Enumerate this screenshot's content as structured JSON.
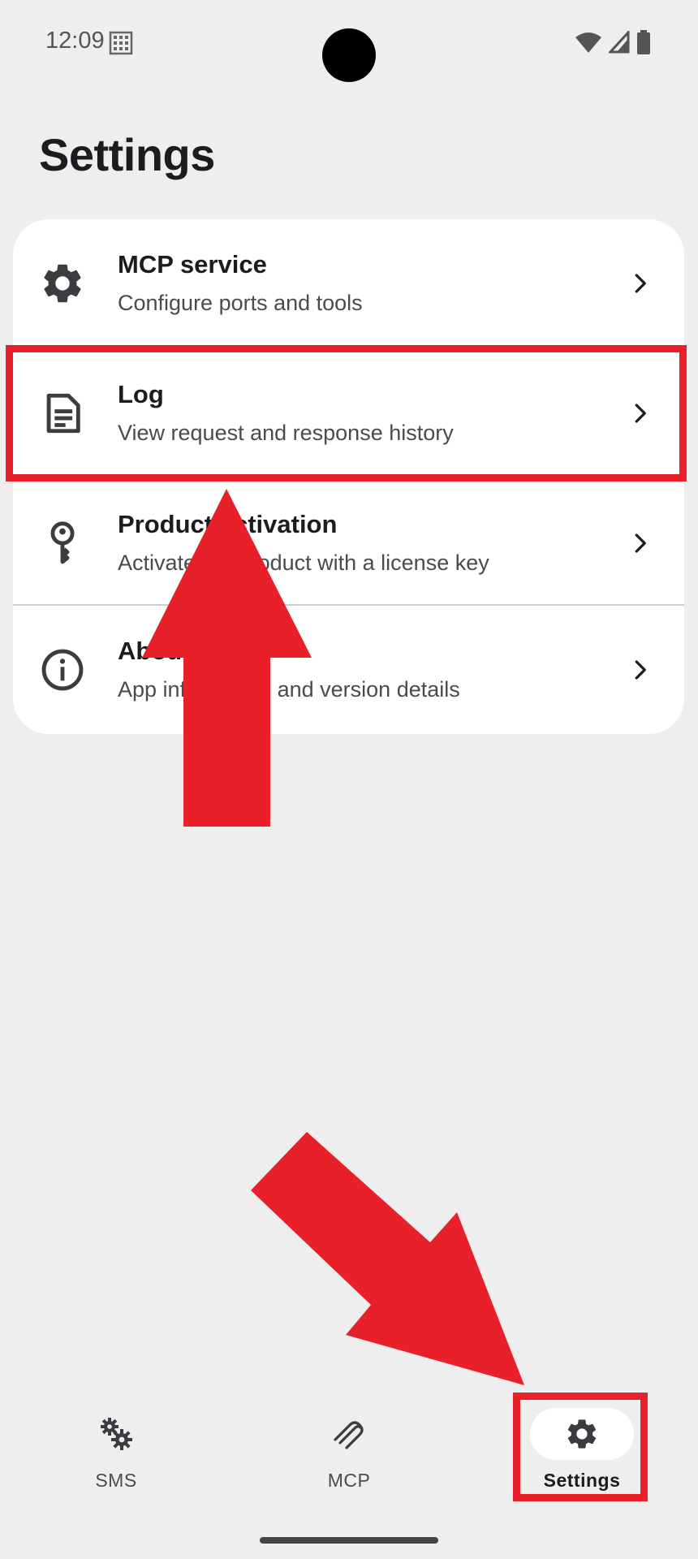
{
  "status_bar": {
    "time": "12:09",
    "icons": [
      "sim-card-icon",
      "wifi-icon",
      "cell-signal-icon",
      "battery-icon"
    ]
  },
  "page": {
    "title": "Settings"
  },
  "settings_items": [
    {
      "icon": "gear-icon",
      "title": "MCP service",
      "subtitle": "Configure ports and tools"
    },
    {
      "icon": "document-icon",
      "title": "Log",
      "subtitle": "View request and response history"
    },
    {
      "icon": "key-icon",
      "title": "Product activation",
      "subtitle": "Activate the product with a license key"
    },
    {
      "icon": "info-icon",
      "title": "About",
      "subtitle": "App information and version details"
    }
  ],
  "bottom_nav": [
    {
      "icon": "gears-icon",
      "label": "SMS",
      "active": false
    },
    {
      "icon": "paperclip-icon",
      "label": "MCP",
      "active": false
    },
    {
      "icon": "gear-icon",
      "label": "Settings",
      "active": true
    }
  ],
  "annotations": {
    "color": "#e8202a",
    "highlighted": [
      "settings-item-log",
      "nav-item-settings"
    ],
    "arrows": [
      "arrow-up-to-log",
      "arrow-down-right-to-settings"
    ]
  }
}
